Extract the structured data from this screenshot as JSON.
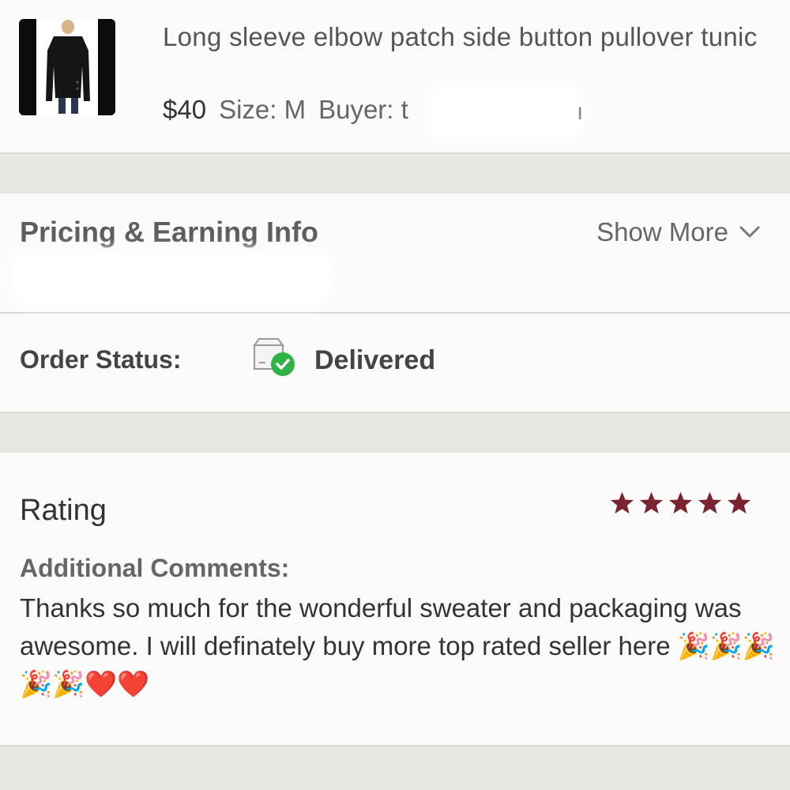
{
  "item": {
    "title": "Long sleeve elbow patch side button pullover tunic",
    "price": "$40",
    "size": "Size: M",
    "buyer_label": "Buyer: t",
    "buyer_tail": "ı"
  },
  "pricing": {
    "title": "Pricing & Earning Info",
    "show_more": "Show More"
  },
  "order_status": {
    "label": "Order Status:",
    "value": "Delivered",
    "icon": "delivered-box-check-icon"
  },
  "rating": {
    "label": "Rating",
    "stars": 5,
    "max_stars": 5,
    "star_color": "#7a2431",
    "comments_label": "Additional Comments:",
    "comments": "Thanks so much for the wonderful sweater and packaging was awesome. I will definately buy more top rated seller here 🎉🎉🎉🎉🎉❤️❤️"
  },
  "colors": {
    "page_bg": "#e9e7e2",
    "card_bg": "#fbfbfb",
    "check_green": "#2fb344"
  }
}
